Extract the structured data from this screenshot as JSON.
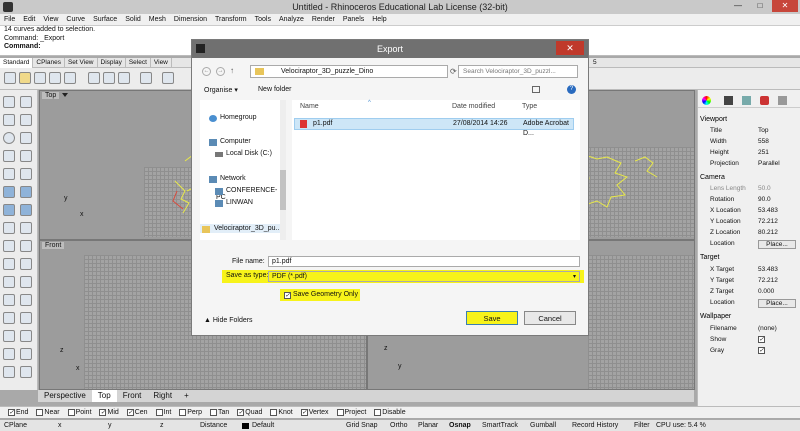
{
  "window": {
    "title": "Untitled - Rhinoceros Educational Lab License (32-bit)",
    "min": "—",
    "max": "□",
    "close": "✕"
  },
  "menu": [
    "File",
    "Edit",
    "View",
    "Curve",
    "Surface",
    "Solid",
    "Mesh",
    "Dimension",
    "Transform",
    "Tools",
    "Analyze",
    "Render",
    "Panels",
    "Help"
  ],
  "command": {
    "line1": "14 curves added to selection.",
    "line2": "Command: _Export",
    "prompt": "Command:"
  },
  "toolbar_tabs": [
    "Standard",
    "CPlanes",
    "Set View",
    "Display",
    "Select",
    "View"
  ],
  "toolbar_tab_right": "5",
  "viewports": {
    "top": "Top",
    "front": "Front",
    "axis_x": "x",
    "axis_y": "y",
    "axis_z": "z"
  },
  "view_tabs": [
    "Perspective",
    "Top",
    "Front",
    "Right",
    "+"
  ],
  "osnap": [
    {
      "label": "End",
      "checked": true
    },
    {
      "label": "Near",
      "checked": false
    },
    {
      "label": "Point",
      "checked": false
    },
    {
      "label": "Mid",
      "checked": true
    },
    {
      "label": "Cen",
      "checked": true
    },
    {
      "label": "Int",
      "checked": false
    },
    {
      "label": "Perp",
      "checked": false
    },
    {
      "label": "Tan",
      "checked": false
    },
    {
      "label": "Quad",
      "checked": true
    },
    {
      "label": "Knot",
      "checked": false
    },
    {
      "label": "Vertex",
      "checked": true
    },
    {
      "label": "Project",
      "checked": false
    },
    {
      "label": "Disable",
      "checked": false
    }
  ],
  "status": {
    "cplane": "CPlane",
    "x": "x",
    "y": "y",
    "z": "z",
    "distance": "Distance",
    "layer": "Default",
    "grid_snap": "Grid Snap",
    "ortho": "Ortho",
    "planar": "Planar",
    "osnap": "Osnap",
    "smarttrack": "SmartTrack",
    "gumball": "Gumball",
    "record_history": "Record History",
    "filter": "Filter",
    "cpu": "CPU use: 5.4 %"
  },
  "panel": {
    "viewport_section": "Viewport",
    "title_label": "Title",
    "title_value": "Top",
    "width_label": "Width",
    "width_value": "558",
    "height_label": "Height",
    "height_value": "251",
    "projection_label": "Projection",
    "projection_value": "Parallel",
    "camera_section": "Camera",
    "lens_label": "Lens Length",
    "lens_value": "50.0",
    "rotation_label": "Rotation",
    "rotation_value": "90.0",
    "xloc_label": "X Location",
    "xloc_value": "53.483",
    "yloc_label": "Y Location",
    "yloc_value": "72.212",
    "zloc_label": "Z Location",
    "zloc_value": "80.212",
    "loc_label": "Location",
    "place_label": "Place...",
    "target_section": "Target",
    "xt_label": "X Target",
    "xt_value": "53.483",
    "yt_label": "Y Target",
    "yt_value": "72.212",
    "zt_label": "Z Target",
    "zt_value": "0.000",
    "wallpaper_section": "Wallpaper",
    "filename_label": "Filename",
    "filename_value": "(none)",
    "show_label": "Show",
    "gray_label": "Gray"
  },
  "dialog": {
    "title": "Export",
    "close": "✕",
    "path": "Velociraptor_3D_puzzle_Dino",
    "search_placeholder": "Search Velociraptor_3D_puzzl...",
    "organise": "Organise ▾",
    "new_folder": "New folder",
    "nav": [
      "Homegroup",
      "Computer",
      "Local Disk (C:)",
      "Network",
      "CONFERENCE-PC",
      "LINWAN",
      "Velociraptor_3D_pu..."
    ],
    "columns": [
      "Name",
      "Date modified",
      "Type"
    ],
    "file": {
      "name": "p1.pdf",
      "date": "27/08/2014 14:26",
      "type": "Adobe Acrobat D..."
    },
    "file_name_label": "File name:",
    "file_name_value": "p1.pdf",
    "save_type_label": "Save as type:",
    "save_type_value": "PDF (*.pdf)",
    "save_geometry_label": "Save Geometry Only",
    "hide_folders": "Hide Folders",
    "save": "Save",
    "cancel": "Cancel"
  },
  "colors": {
    "highlight": "#f7f31a",
    "dialog_title": "#707070",
    "close_red": "#c0392b",
    "curves": "#e8e84a"
  }
}
